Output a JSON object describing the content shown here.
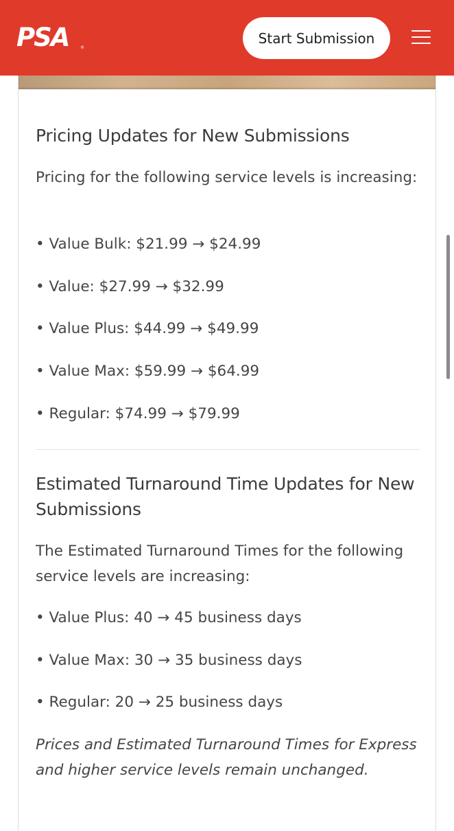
{
  "header": {
    "logo": "PSA",
    "logo_tm": "®",
    "start_submission_label": "Start Submission",
    "menu_icon": "hamburger-menu-icon",
    "background_color": "#e03a2b"
  },
  "pricing": {
    "title": "Pricing Updates for New Submissions",
    "intro": "Pricing for the following service levels is increasing:",
    "items": [
      "• Value Bulk: $21.99 → $24.99",
      "• Value: $27.99 → $32.99",
      "• Value Plus: $44.99 → $49.99",
      "• Value Max: $59.99 → $64.99",
      "• Regular: $74.99 → $79.99"
    ]
  },
  "turnaround": {
    "title": "Estimated Turnaround Time Updates for New Submissions",
    "intro": "The Estimated Turnaround Times for the following service levels are increasing:",
    "items": [
      "• Value Plus: 40 → 45 business days",
      "• Value Max: 30 → 35 business days",
      "• Regular: 20 → 25 business days"
    ],
    "note": "Prices and Estimated Turnaround Times for Express and higher service levels remain unchanged."
  }
}
